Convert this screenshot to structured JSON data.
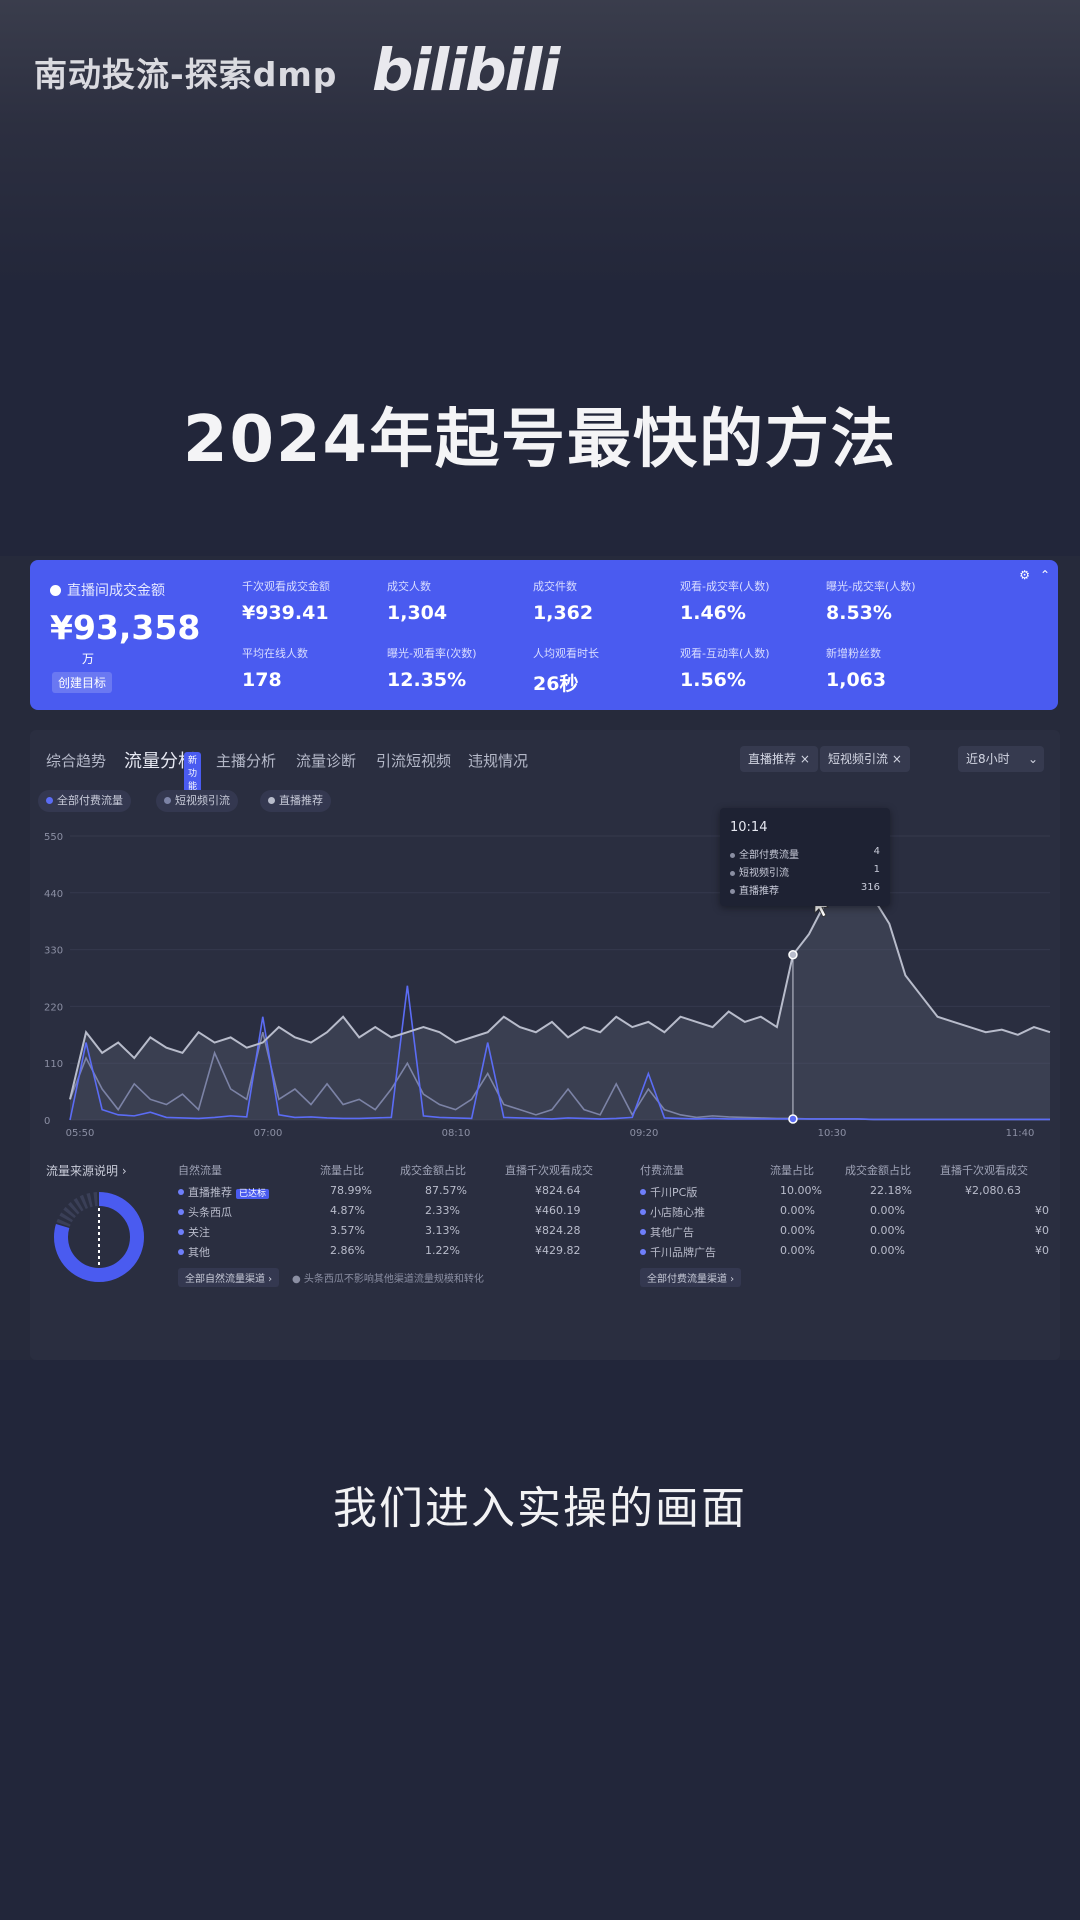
{
  "overlay": {
    "watermark": "南动投流-探索dmp",
    "platform_logo": "bilibili",
    "title": "2024年起号最快的方法",
    "subtitle": "我们进入实操的画面"
  },
  "kpi": {
    "main_label": "直播间成交金额",
    "main_value": "¥93,358",
    "main_unit": "万",
    "create_target": "创建目标",
    "cells": [
      {
        "label": "千次观看成交金额",
        "value": "¥939.41"
      },
      {
        "label": "成交人数",
        "value": "1,304"
      },
      {
        "label": "成交件数",
        "value": "1,362"
      },
      {
        "label": "观看-成交率(人数)",
        "value": "1.46%"
      },
      {
        "label": "曝光-成交率(人数)",
        "value": "8.53%"
      },
      {
        "label": "平均在线人数",
        "value": "178"
      },
      {
        "label": "曝光-观看率(次数)",
        "value": "12.35%"
      },
      {
        "label": "人均观看时长",
        "value": "26秒"
      },
      {
        "label": "观看-互动率(人数)",
        "value": "1.56%"
      },
      {
        "label": "新增粉丝数",
        "value": "1,063"
      }
    ]
  },
  "analysis": {
    "tabs": [
      "综合趋势",
      "流量分析",
      "主播分析",
      "流量诊断",
      "引流短视频",
      "违规情况"
    ],
    "active_tab": "流量分析",
    "tab_badge": "新功能",
    "filters": [
      "直播推荐 ×",
      "短视频引流 ×"
    ],
    "time_range": "近8小时",
    "legend": [
      {
        "label": "全部付费流量",
        "color": "#5b6cf5"
      },
      {
        "label": "短视频引流",
        "color": "#7c83a6"
      },
      {
        "label": "直播推荐",
        "color": "#b8bccb"
      }
    ],
    "tooltip": {
      "time": "10:14",
      "rows": [
        {
          "label": "全部付费流量",
          "value": "4"
        },
        {
          "label": "短视频引流",
          "value": "1"
        },
        {
          "label": "直播推荐",
          "value": "316"
        }
      ]
    }
  },
  "chart_data": {
    "type": "line",
    "y_ticks": [
      "0",
      "110",
      "220",
      "330",
      "440",
      "550"
    ],
    "x_ticks": [
      "05:50",
      "07:00",
      "08:10",
      "09:20",
      "10:30",
      "11:40"
    ],
    "ylim": [
      0,
      550
    ],
    "series": [
      {
        "name": "全部付费流量",
        "color": "#5b6cf5",
        "values": [
          0,
          150,
          20,
          10,
          8,
          15,
          5,
          4,
          3,
          5,
          8,
          6,
          200,
          10,
          5,
          6,
          4,
          3,
          3,
          4,
          5,
          260,
          8,
          5,
          4,
          3,
          150,
          5,
          4,
          3,
          2,
          4,
          3,
          2,
          3,
          5,
          90,
          4,
          3,
          2,
          3,
          2,
          2,
          2,
          2,
          2,
          2,
          2,
          2,
          2,
          1,
          1,
          1,
          1,
          1,
          1,
          1,
          1,
          1,
          1,
          1,
          1
        ]
      },
      {
        "name": "短视频引流",
        "color": "#7c83a6",
        "values": [
          40,
          120,
          60,
          20,
          70,
          40,
          30,
          50,
          20,
          130,
          60,
          40,
          170,
          40,
          60,
          30,
          70,
          30,
          40,
          20,
          60,
          110,
          50,
          30,
          20,
          40,
          90,
          30,
          20,
          10,
          20,
          60,
          20,
          10,
          70,
          10,
          60,
          20,
          10,
          5,
          8,
          6,
          5,
          4,
          3,
          3,
          2,
          2,
          2,
          2,
          1,
          1,
          1,
          1,
          1,
          1,
          1,
          1,
          1,
          1,
          1,
          1
        ]
      },
      {
        "name": "直播推荐",
        "color": "#b8bccb",
        "values": [
          40,
          170,
          130,
          150,
          120,
          160,
          140,
          130,
          170,
          150,
          160,
          140,
          150,
          180,
          160,
          150,
          170,
          200,
          160,
          180,
          160,
          170,
          180,
          170,
          150,
          160,
          170,
          200,
          180,
          170,
          190,
          160,
          180,
          170,
          200,
          180,
          190,
          170,
          200,
          190,
          180,
          210,
          190,
          200,
          180,
          320,
          360,
          420,
          480,
          520,
          430,
          380,
          280,
          240,
          200,
          190,
          180,
          170,
          175,
          165,
          180,
          170
        ]
      }
    ]
  },
  "sources": {
    "title": "流量来源说明 ›",
    "natural_header": [
      "自然流量",
      "流量占比",
      "成交金额占比",
      "直播千次观看成交"
    ],
    "natural_rows": [
      [
        "直播推荐",
        "78.99%",
        "87.57%",
        "¥824.64"
      ],
      [
        "头条西瓜",
        "4.87%",
        "2.33%",
        "¥460.19"
      ],
      [
        "关注",
        "3.57%",
        "3.13%",
        "¥824.28"
      ],
      [
        "其他",
        "2.86%",
        "1.22%",
        "¥429.82"
      ]
    ],
    "natural_badge": "已达标",
    "paid_header": [
      "付费流量",
      "流量占比",
      "成交金额占比",
      "直播千次观看成交"
    ],
    "paid_rows": [
      [
        "千川PC版",
        "10.00%",
        "22.18%",
        "¥2,080.63"
      ],
      [
        "小店随心推",
        "0.00%",
        "0.00%",
        "¥0"
      ],
      [
        "其他广告",
        "0.00%",
        "0.00%",
        "¥0"
      ],
      [
        "千川品牌广告",
        "0.00%",
        "0.00%",
        "¥0"
      ]
    ],
    "natural_footer": "全部自然流量渠道 ›",
    "footer_note": "头条西瓜不影响其他渠道流量规模和转化",
    "paid_footer": "全部付费流量渠道 ›"
  }
}
